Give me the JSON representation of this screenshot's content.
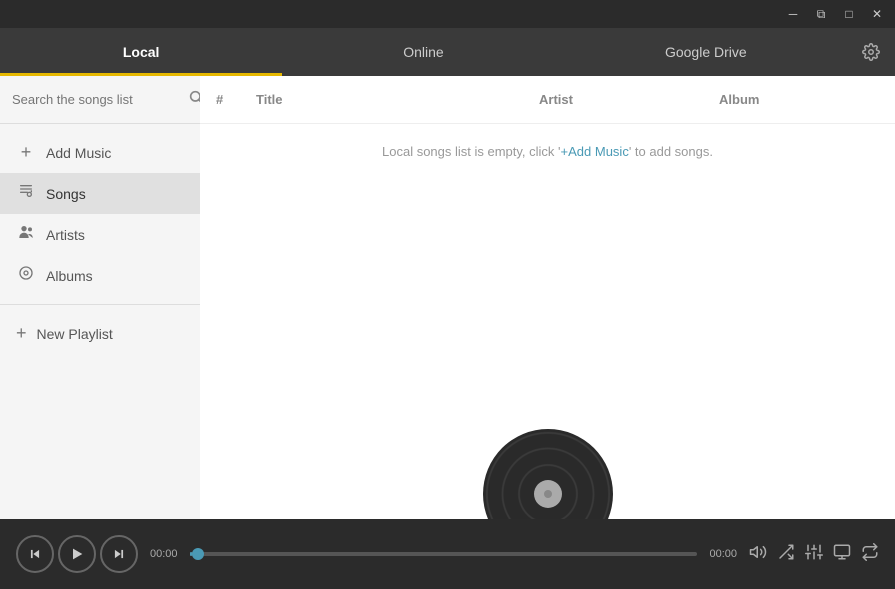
{
  "window": {
    "minimize_label": "─",
    "maximize_label": "□",
    "close_label": "✕",
    "restore_label": "⧉"
  },
  "tabs": [
    {
      "id": "local",
      "label": "Local",
      "active": true
    },
    {
      "id": "online",
      "label": "Online",
      "active": false
    },
    {
      "id": "google_drive",
      "label": "Google Drive",
      "active": false
    }
  ],
  "sidebar": {
    "search_placeholder": "Search the songs list",
    "nav_items": [
      {
        "id": "add_music",
        "label": "Add Music",
        "icon": "+"
      },
      {
        "id": "songs",
        "label": "Songs",
        "active": true
      },
      {
        "id": "artists",
        "label": "Artists"
      },
      {
        "id": "albums",
        "label": "Albums"
      }
    ],
    "new_playlist_label": "New Playlist"
  },
  "table": {
    "columns": [
      {
        "id": "num",
        "label": "#"
      },
      {
        "id": "title",
        "label": "Title"
      },
      {
        "id": "artist",
        "label": "Artist"
      },
      {
        "id": "album",
        "label": "Album"
      }
    ],
    "empty_message_prefix": "Local songs list is empty, click '",
    "empty_message_link": "+Add Music",
    "empty_message_suffix": "' to add songs."
  },
  "player": {
    "current_time": "00:00",
    "total_time": "00:00",
    "progress_percent": 0,
    "volume_icon": "🔊",
    "shuffle_active": false,
    "repeat_active": false
  }
}
